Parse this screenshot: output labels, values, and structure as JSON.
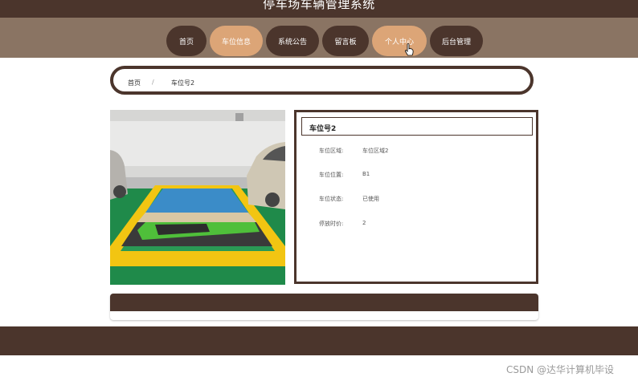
{
  "site": {
    "title": "停车场车辆管理系统"
  },
  "nav": {
    "items": [
      {
        "label": "首页"
      },
      {
        "label": "车位信息"
      },
      {
        "label": "系统公告"
      },
      {
        "label": "留言板"
      },
      {
        "label": "个人中心"
      },
      {
        "label": "后台管理"
      }
    ],
    "active_index": 1,
    "hover_index": 4
  },
  "breadcrumb": {
    "home": "首页",
    "separator": "/",
    "current": "车位号2"
  },
  "detail": {
    "title": "车位号2",
    "fields": [
      {
        "label": "车位区域:",
        "value": "车位区域2"
      },
      {
        "label": "车位位置:",
        "value": "B1"
      },
      {
        "label": "车位状态:",
        "value": "已使用"
      },
      {
        "label": "停放时价:",
        "value": "2"
      }
    ]
  },
  "watermark": "CSDN @达华计算机毕设",
  "colors": {
    "brand_dark": "#4b352c",
    "nav_band": "#8a7463",
    "accent": "#dca577"
  }
}
